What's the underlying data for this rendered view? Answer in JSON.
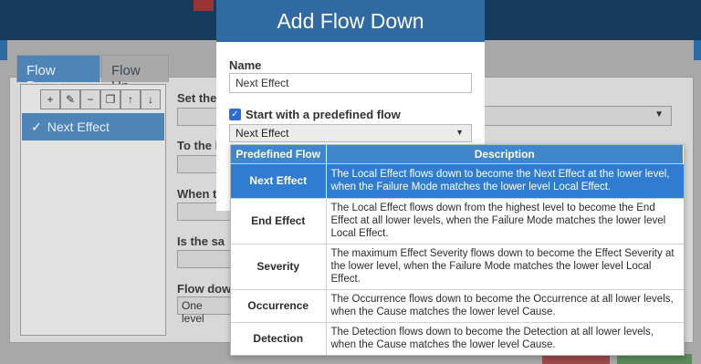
{
  "background": {
    "tabs": [
      "Flow Down",
      "Flow Up"
    ],
    "toolbar_icons": [
      "plus-icon",
      "pencil-icon",
      "minus-icon",
      "copy-icon",
      "arrow-up-icon",
      "arrow-down-icon"
    ],
    "list_items": [
      {
        "label": "Next Effect",
        "checked": true
      }
    ],
    "labels": [
      "Set the",
      "To the l",
      "When t",
      "Is the sa",
      "Flow dow"
    ],
    "flow_down_value": "One level"
  },
  "modal": {
    "title": "Add Flow Down",
    "name_label": "Name",
    "name_value": "Next Effect",
    "predefined_label": "Start with a predefined flow",
    "predefined_checked": true,
    "selected_flow": "Next Effect"
  },
  "dropdown": {
    "headers": [
      "Predefined Flow",
      "Description"
    ],
    "rows": [
      {
        "name": "Next Effect",
        "description": "The Local Effect flows down to become the Next Effect at the lower level, when the Failure Mode matches the lower level Local Effect.",
        "selected": true
      },
      {
        "name": "End Effect",
        "description": "The Local Effect flows down from the highest level to become the End Effect at all lower levels, when the Failure Mode matches the lower level Local Effect."
      },
      {
        "name": "Severity",
        "description": "The maximum Effect Severity flows down to become the Effect Severity at the lower level, when the Failure Mode matches the lower level Local Effect."
      },
      {
        "name": "Occurrence",
        "description": "The Occurrence flows down to become the Occurrence at all lower levels, when the Cause matches the lower level Cause."
      },
      {
        "name": "Detection",
        "description": "The Detection flows down to become the Detection at all lower levels, when the Cause matches the lower level Cause."
      }
    ]
  },
  "colors": {
    "accent": "#2f6aa3",
    "selected_row": "#2f7cd0",
    "table_header": "#3f86cc"
  }
}
